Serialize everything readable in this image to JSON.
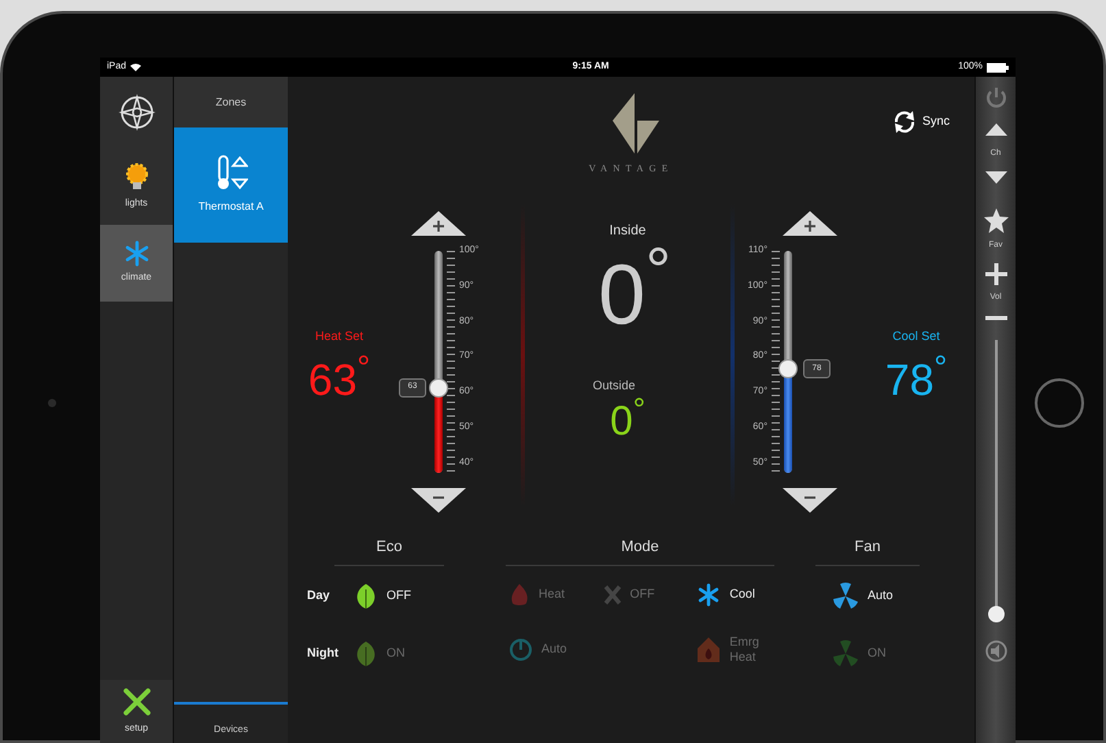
{
  "status_bar": {
    "carrier": "iPad",
    "time": "9:15 AM",
    "battery": "100%"
  },
  "nav": {
    "items": [
      {
        "kind": "compass",
        "selected": false
      },
      {
        "kind": "bulb",
        "label": "lights",
        "selected": false
      },
      {
        "kind": "snowflake",
        "label": "climate",
        "selected": true
      }
    ],
    "footer_item": {
      "kind": "tools",
      "label": "setup",
      "selected": false
    }
  },
  "zones": {
    "title": "Zones",
    "items": [
      {
        "label": "Thermostat A",
        "selected": true
      }
    ],
    "footer": "Devices"
  },
  "logo": {
    "wordmark": "VANTAGE"
  },
  "sync_button": {
    "label": "Sync"
  },
  "setpoints": [
    {
      "kind": "heat",
      "title": "Heat Set",
      "value": "63$^{°}$",
      "badge": "63",
      "level": 0.383,
      "scale": [
        "100°",
        "90°",
        "80°",
        "70°",
        "60°",
        "50°",
        "40°"
      ]
    },
    {
      "kind": "cool",
      "title": "Cool Set",
      "value": "78$^{°}$",
      "badge": "78",
      "level": 0.467,
      "scale": [
        "110°",
        "100°",
        "90°",
        "80°",
        "70°",
        "60°",
        "50°"
      ]
    }
  ],
  "inside": {
    "label": "Inside",
    "value": "0$^{°}$"
  },
  "outside": {
    "label": "Outside",
    "value": "0$^{°}$"
  },
  "eco": {
    "title": "Eco",
    "rows": [
      {
        "label": "Day",
        "option": "OFF",
        "selected": true
      },
      {
        "label": "Night",
        "option": "ON",
        "selected": false
      }
    ]
  },
  "mode": {
    "title": "Mode",
    "rows": [
      [
        {
          "kind": "heat",
          "label": "Heat",
          "selected": false
        },
        {
          "kind": "off",
          "label": "OFF",
          "selected": false
        },
        {
          "kind": "cool",
          "label": "Cool",
          "selected": true
        }
      ],
      [
        {
          "kind": "auto",
          "label": "Auto",
          "selected": false
        },
        "",
        {
          "kind": "emergency_heat",
          "label": "Emrg Heat",
          "selected": false
        }
      ]
    ]
  },
  "fan": {
    "title": "Fan",
    "options": [
      {
        "kind": "auto",
        "label": "Auto",
        "selected": true
      },
      {
        "kind": "on",
        "label": "ON",
        "selected": false
      }
    ]
  },
  "remote": {
    "items": [
      {
        "kind": "power"
      },
      {
        "kind": "up"
      },
      {
        "kind": "label",
        "label": "Ch"
      },
      {
        "kind": "down"
      },
      {
        "kind": "star"
      },
      {
        "kind": "label",
        "label": "Fav"
      },
      {
        "kind": "plus"
      },
      {
        "kind": "label",
        "label": "Vol"
      },
      {
        "kind": "minus"
      },
      {
        "kind": "slider",
        "level": 0
      },
      {
        "kind": "mute"
      }
    ]
  }
}
